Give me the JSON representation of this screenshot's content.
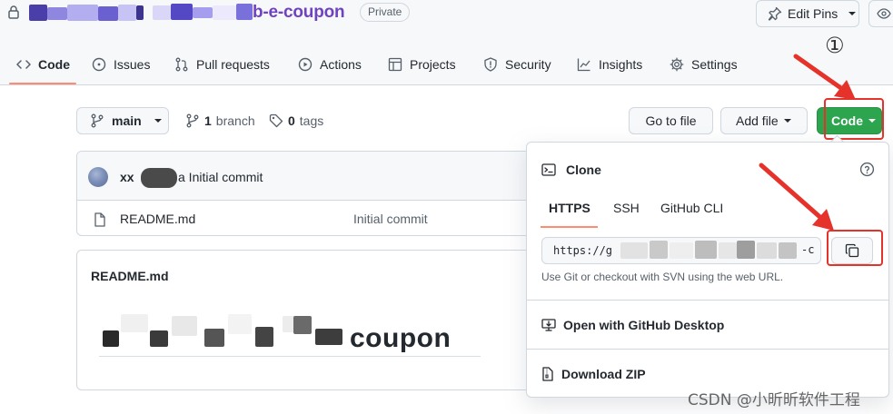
{
  "repo": {
    "name_visible_suffix": "b-e-coupon",
    "visibility_badge": "Private"
  },
  "header_buttons": {
    "edit_pins": "Edit Pins"
  },
  "tabs": [
    {
      "label": "Code",
      "icon": "code-icon",
      "active": true
    },
    {
      "label": "Issues",
      "icon": "issue-opened-icon",
      "active": false
    },
    {
      "label": "Pull requests",
      "icon": "git-pull-request-icon",
      "active": false
    },
    {
      "label": "Actions",
      "icon": "play-icon",
      "active": false
    },
    {
      "label": "Projects",
      "icon": "table-icon",
      "active": false
    },
    {
      "label": "Security",
      "icon": "shield-icon",
      "active": false
    },
    {
      "label": "Insights",
      "icon": "graph-icon",
      "active": false
    },
    {
      "label": "Settings",
      "icon": "gear-icon",
      "active": false
    }
  ],
  "annotation_marker": "①",
  "toolbar": {
    "branch": "main",
    "branch_count": "1",
    "branch_label": "branch",
    "tag_count": "0",
    "tag_label": "tags",
    "go_to_file": "Go to file",
    "add_file": "Add file",
    "code": "Code"
  },
  "latest_commit": {
    "author_visible": "xx",
    "message": "a Initial commit"
  },
  "files": [
    {
      "name": "README.md",
      "commit_message": "Initial commit",
      "icon": "file-icon"
    }
  ],
  "readme": {
    "title": "README.md",
    "heading_visible": "coupon"
  },
  "clone_panel": {
    "title": "Clone",
    "tabs": [
      "HTTPS",
      "SSH",
      "GitHub CLI"
    ],
    "active_tab": "HTTPS",
    "url_visible_start": "https://g",
    "url_visible_end": "-c",
    "hint": "Use Git or checkout with SVN using the web URL.",
    "open_desktop": "Open with GitHub Desktop",
    "download_zip": "Download ZIP"
  },
  "watermark": "CSDN @小昕昕软件工程",
  "colors": {
    "accent_green": "#2da44e",
    "tab_underline": "#fd8c73",
    "annotation_red": "#e5322a",
    "repo_link_purple": "#6f42c1"
  }
}
